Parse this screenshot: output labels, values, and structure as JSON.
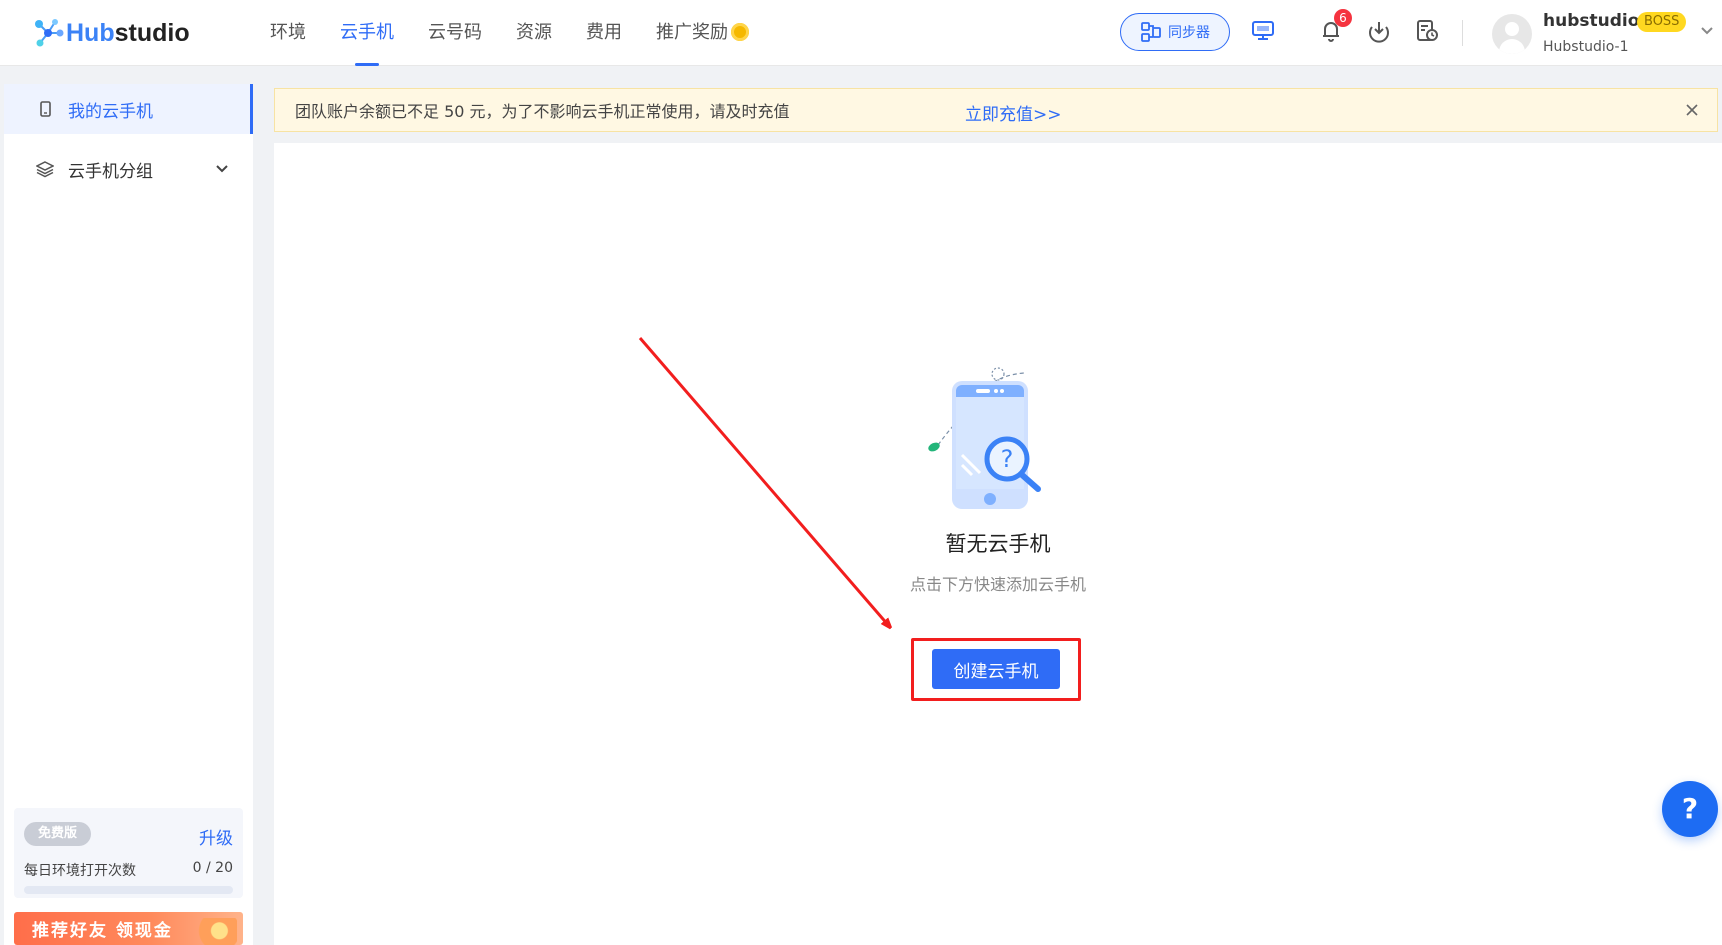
{
  "header": {
    "logo": {
      "hub": "Hub",
      "studio": "studio"
    },
    "nav": [
      {
        "label": "环境"
      },
      {
        "label": "云手机"
      },
      {
        "label": "云号码"
      },
      {
        "label": "资源"
      },
      {
        "label": "费用"
      },
      {
        "label": "推广奖励"
      }
    ],
    "sync_button": "同步器",
    "notification_count": "6",
    "user": {
      "name": "hubstudio",
      "role_badge": "BOSS",
      "team": "Hubstudio-1"
    }
  },
  "sidebar": {
    "items": [
      {
        "label": "我的云手机"
      },
      {
        "label": "云手机分组"
      }
    ],
    "plan": {
      "badge": "免费版",
      "upgrade": "升级",
      "quota_label": "每日环境打开次数",
      "quota_value": "0 / 20",
      "quota_used_fraction": 0
    },
    "referral": "推荐好友 领现金"
  },
  "notice": {
    "text": "团队账户余额已不足 50 元，为了不影响云手机正常使用，请及时充值",
    "link": "立即充值>>"
  },
  "empty_state": {
    "title": "暂无云手机",
    "subtitle": "点击下方快速添加云手机",
    "button": "创建云手机"
  },
  "help": "?",
  "colors": {
    "primary": "#2f6cf6",
    "highlight": "#f21e1e",
    "notice_bg": "#fff8e3"
  }
}
